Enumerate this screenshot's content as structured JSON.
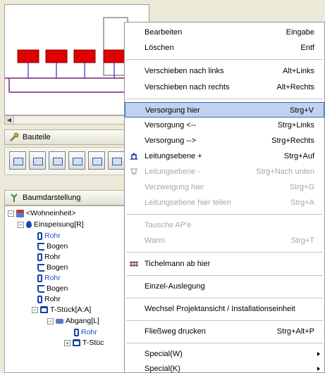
{
  "panels": {
    "bauteile_label": "Bauteile",
    "baum_label": "Baumdarstellung"
  },
  "tree": [
    {
      "label": "<Wohneinheit>",
      "icon": "house-icon",
      "color": "#000000"
    },
    {
      "label": "Einspeisung[R]",
      "icon": "drop-icon",
      "color": "#000000"
    },
    {
      "label": "Rohr",
      "icon": "pipe-icon",
      "color": "#1c54c9"
    },
    {
      "label": "Bogen",
      "icon": "bend-icon",
      "color": "#000000"
    },
    {
      "label": "Rohr",
      "icon": "pipe-icon",
      "color": "#000000"
    },
    {
      "label": "Bogen",
      "icon": "bend-icon",
      "color": "#000000"
    },
    {
      "label": "Rohr",
      "icon": "pipe-icon",
      "color": "#1c54c9"
    },
    {
      "label": "Bogen",
      "icon": "bend-icon",
      "color": "#000000"
    },
    {
      "label": "Rohr",
      "icon": "pipe-icon",
      "color": "#000000"
    },
    {
      "label": "T-Stück[A:A]",
      "icon": "tee-icon",
      "color": "#000000"
    },
    {
      "label": "Abgang[L]",
      "icon": "branch-icon",
      "color": "#000000"
    },
    {
      "label": "Rohr",
      "icon": "pipe-icon",
      "color": "#1c54c9"
    },
    {
      "label": "T-Stüc",
      "icon": "tee-icon",
      "color": "#000000"
    }
  ],
  "menu": [
    {
      "label": "Bearbeiten",
      "shortcut": "Eingabe",
      "disabled": false
    },
    {
      "label": "Löschen",
      "shortcut": "Entf",
      "disabled": false
    },
    {
      "label": "Verschieben nach links",
      "shortcut": "Alt+Links",
      "disabled": false
    },
    {
      "label": "Verschieben nach rechts",
      "shortcut": "Alt+Rechts",
      "disabled": false
    },
    {
      "label": "Versorgung hier",
      "shortcut": "Strg+V",
      "disabled": false,
      "highlighted": true
    },
    {
      "label": "Versorgung <--",
      "shortcut": "Strg+Links",
      "disabled": false
    },
    {
      "label": "Versorgung -->",
      "shortcut": "Strg+Rechts",
      "disabled": false
    },
    {
      "label": "Leitungsebene +",
      "shortcut": "Strg+Auf",
      "disabled": false,
      "icon": "level-up-icon"
    },
    {
      "label": "Leitungsebene -",
      "shortcut": "Strg+Nach unten",
      "disabled": true,
      "icon": "level-down-icon"
    },
    {
      "label": "Verzweigung hier",
      "shortcut": "Strg+G",
      "disabled": true
    },
    {
      "label": "Leitungsebene hier teilen",
      "shortcut": "Strg+A",
      "disabled": true
    },
    {
      "label": "Tausche AP'e",
      "shortcut": "",
      "disabled": true
    },
    {
      "label": "Warm",
      "shortcut": "Strg+T",
      "disabled": true
    },
    {
      "label": "Tichelmann ab hier",
      "shortcut": "",
      "disabled": false,
      "icon": "tichelmann-icon"
    },
    {
      "label": "Einzel-Auslegung",
      "shortcut": "",
      "disabled": false
    },
    {
      "label": "Wechsel Projektansicht / Installationseinheit",
      "shortcut": "",
      "disabled": false
    },
    {
      "label": "Fließweg drucken",
      "shortcut": "Strg+Alt+P",
      "disabled": false
    },
    {
      "label": "Special(W)",
      "shortcut": "",
      "disabled": false,
      "submenu": true
    },
    {
      "label": "Special(K)",
      "shortcut": "",
      "disabled": false,
      "submenu": true
    }
  ]
}
